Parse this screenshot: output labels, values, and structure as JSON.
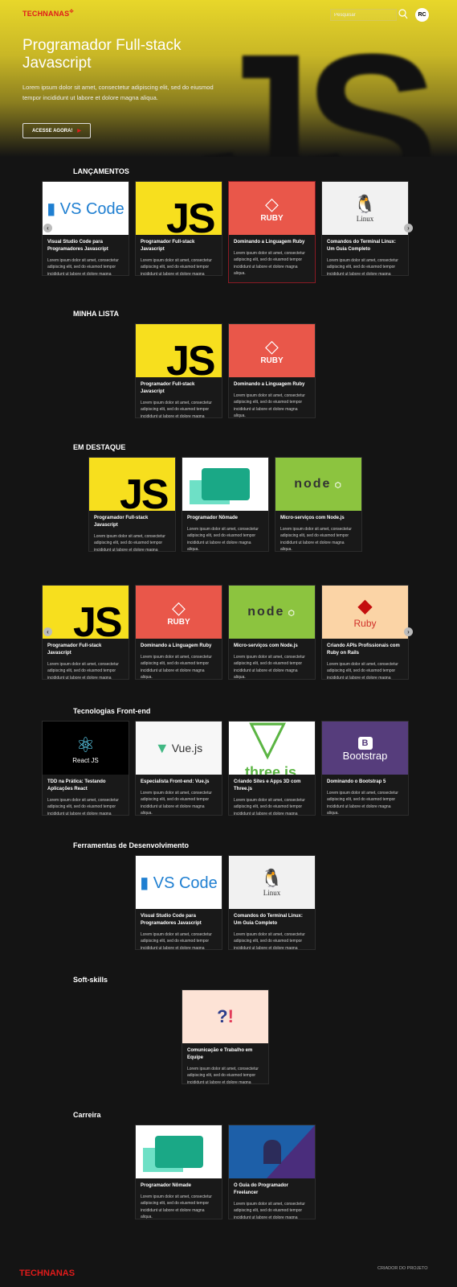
{
  "header": {
    "logo": "TECHNANAS",
    "search_placeholder": "Pesquisar",
    "avatar_initials": "RC"
  },
  "hero": {
    "title": "Programador Full-stack Javascript",
    "description": "Lorem ipsum dolor sit amet, consectetur adipiscing elit, sed do eiusmod tempor incididunt ut labore et dolore magna aliqua.",
    "cta_label": "ACESSE AGORA!",
    "background_text": "JS"
  },
  "sections": [
    {
      "title": "LANÇAMENTOS",
      "carousel": true,
      "cards": [
        {
          "title": "Visual Studio Code para Programadores Javascript",
          "image": "vscode"
        },
        {
          "title": "Programador Full-stack Javascript",
          "image": "js"
        },
        {
          "title": "Dominando a Linguagem Ruby",
          "image": "ruby",
          "active": true
        },
        {
          "title": "Comandos do Terminal Linux: Um Guia Completo",
          "image": "linux"
        }
      ]
    },
    {
      "title": "MINHA LISTA",
      "cards": [
        {
          "title": "Programador Full-stack Javascript",
          "image": "js"
        },
        {
          "title": "Dominando a Linguagem Ruby",
          "image": "ruby"
        }
      ]
    },
    {
      "title": "EM DESTAQUE",
      "cards": [
        {
          "title": "Programador Full-stack Javascript",
          "image": "js"
        },
        {
          "title": "Programador Nômade",
          "image": "nomad"
        },
        {
          "title": "Micro-serviços com Node.js",
          "image": "node"
        }
      ]
    },
    {
      "title": "",
      "carousel": true,
      "cards": [
        {
          "title": "Programador Full-stack Javascript",
          "image": "js"
        },
        {
          "title": "Dominando a Linguagem Ruby",
          "image": "ruby"
        },
        {
          "title": "Micro-serviços com Node.js",
          "image": "node"
        },
        {
          "title": "Criando APIs Profissionais com Ruby on Rails",
          "image": "rubyrails"
        }
      ]
    },
    {
      "title": "Tecnologias Front-end",
      "cards": [
        {
          "title": "TDD na Prática: Testando Aplicações React",
          "image": "react"
        },
        {
          "title": "Especialista Front-end: Vue.js",
          "image": "vue"
        },
        {
          "title": "Criando Sites e Apps 3D com Three.js",
          "image": "three"
        },
        {
          "title": "Dominando o Bootstrap 5",
          "image": "bootstrap"
        }
      ]
    },
    {
      "title": "Ferramentas de Desenvolvimento",
      "cards": [
        {
          "title": "Visual Studio Code para Programadores Javascript",
          "image": "vscode"
        },
        {
          "title": "Comandos do Terminal Linux: Um Guia Completo",
          "image": "linux"
        }
      ]
    },
    {
      "title": "Soft-skills",
      "cards": [
        {
          "title": "Comunicação e Trabalho em Equipe",
          "image": "softskills"
        }
      ]
    },
    {
      "title": "Carreira",
      "cards": [
        {
          "title": "Programador Nômade",
          "image": "nomad"
        },
        {
          "title": "O Guia do Programador Freelancer",
          "image": "freelancer"
        }
      ]
    }
  ],
  "card_description": "Lorem ipsum dolor sit amet, consectetur adipiscing elit, sed do eiusmod tempor incididunt ut labore et dolore magna aliqua.",
  "thumb_labels": {
    "vscode": "VS Code",
    "js": "JS",
    "ruby": "RUBY",
    "linux": "Linux",
    "node": "node",
    "rubyrails": "Ruby",
    "react": "React JS",
    "vue": "Vue.js",
    "three": "three.js",
    "bootstrap": "Bootstrap"
  },
  "colors": {
    "accent": "#e01b1b",
    "background": "#141414",
    "hero_yellow": "#e8d72a",
    "js_yellow": "#f7df1e",
    "ruby_red": "#e9574a",
    "node_green": "#8cc43f",
    "bootstrap_purple": "#563d7c"
  },
  "footer": {
    "logo": "TECHNANAS",
    "link": "CRIADOR DO PROJETO"
  }
}
